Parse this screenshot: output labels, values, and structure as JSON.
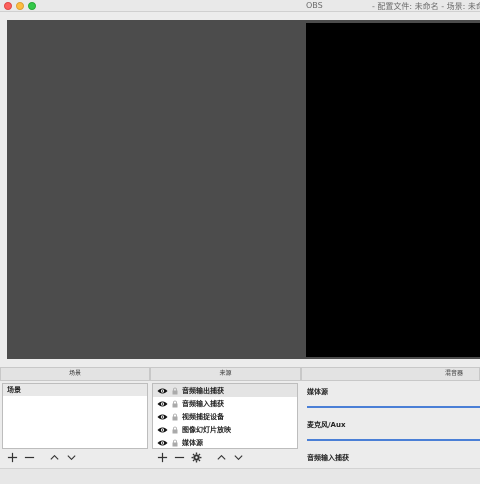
{
  "window": {
    "app_title": "OBS",
    "info_title": "- 配置文件: 未命名 - 场景: 未命名"
  },
  "docks": {
    "scenes": "场景",
    "sources": "来源",
    "mixer": "混音器"
  },
  "scenes": {
    "items": [
      "场景"
    ]
  },
  "sources": {
    "items": [
      {
        "label": "音频输出捕获",
        "icon": "eye-icon"
      },
      {
        "label": "音频输入捕获",
        "icon": "eye-icon"
      },
      {
        "label": "视频捕捉设备",
        "icon": "eye-icon"
      },
      {
        "label": "图像幻灯片放映",
        "icon": "eye-icon"
      },
      {
        "label": "媒体源",
        "icon": "eye-icon"
      }
    ]
  },
  "mixer": {
    "channels": [
      "媒体源",
      "麦克风/Aux",
      "音频输入捕获"
    ],
    "accent": "#4a7fd6"
  },
  "colors": {
    "preview_bg": "#4c4c4c",
    "canvas_bg": "#000000"
  }
}
